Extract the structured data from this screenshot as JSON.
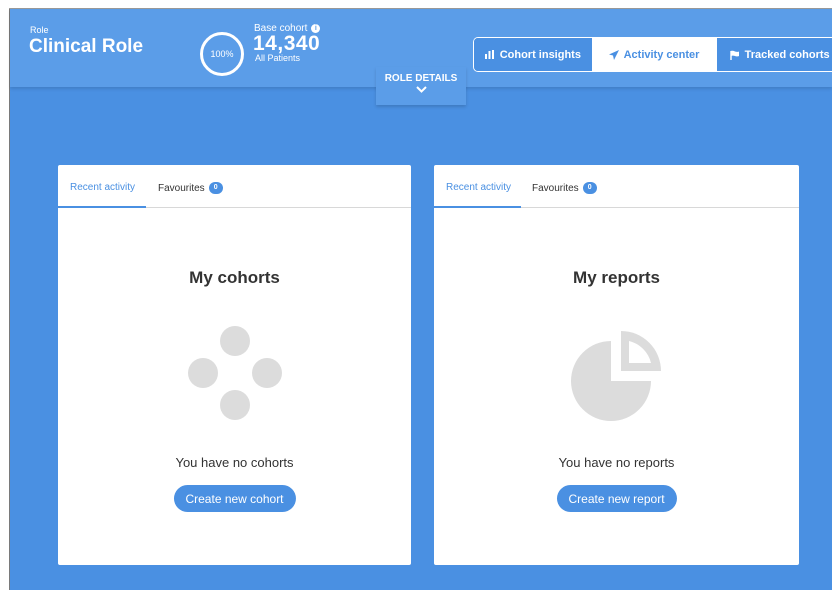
{
  "header": {
    "role_label": "Role",
    "role_name": "Clinical Role",
    "cohort_percent": "100%",
    "base_cohort_label": "Base cohort",
    "base_cohort_count": "14,340",
    "base_cohort_sub": "All Patients",
    "role_details_label": "ROLE DETAILS"
  },
  "nav": {
    "cohort_insights": "Cohort insights",
    "activity_center": "Activity center",
    "tracked_cohorts": "Tracked cohorts",
    "active": "Activity center"
  },
  "cohorts_card": {
    "tab_recent": "Recent activity",
    "tab_favourites": "Favourites",
    "favourites_count": "0",
    "title": "My cohorts",
    "empty_text": "You have no cohorts",
    "button_label": "Create new cohort"
  },
  "reports_card": {
    "tab_recent": "Recent activity",
    "tab_favourites": "Favourites",
    "favourites_count": "0",
    "title": "My reports",
    "empty_text": "You have no reports",
    "button_label": "Create new report"
  },
  "colors": {
    "accent": "#4a90e2",
    "header": "#5b9de8",
    "placeholder_gray": "#dcdcdc"
  }
}
